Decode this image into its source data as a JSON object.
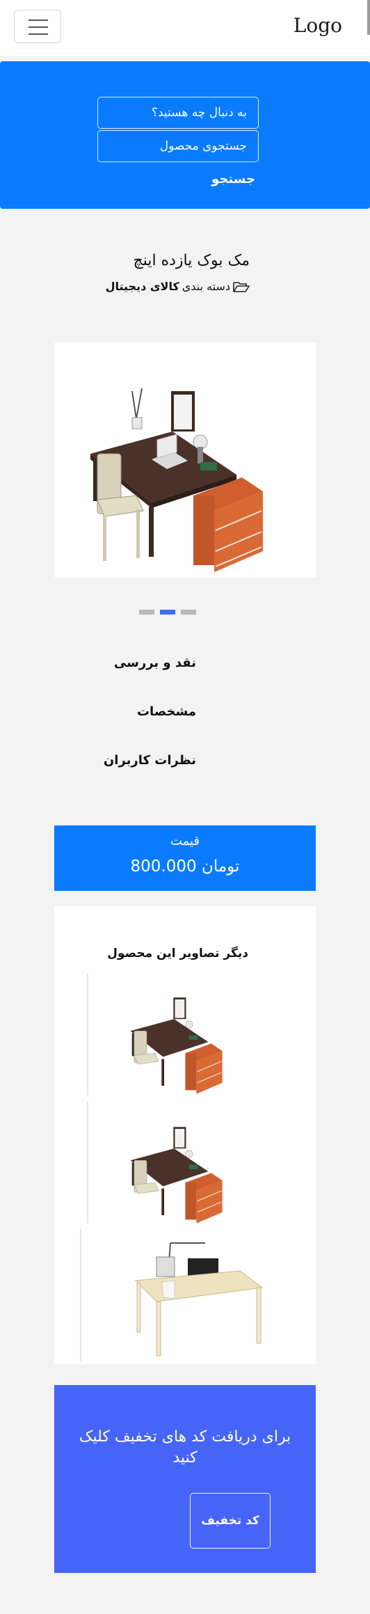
{
  "navbar": {
    "logo": "Logo",
    "menu_icon": "hamburger-icon"
  },
  "search": {
    "placeholder_question": "به دنبال چه هستید؟",
    "placeholder_product": "جستجوی محصول",
    "submit_label": "جستجو"
  },
  "product": {
    "title": "مک بوک یازده اینچ",
    "category_label": "دسته بندی",
    "category_value": "کالای دیجیتال",
    "category_icon": "folder-open-icon"
  },
  "carousel": {
    "total": 3,
    "active_index": 2
  },
  "tabs": [
    "نقد و بررسی",
    "مشخصات",
    "نظرات کاربران"
  ],
  "price": {
    "label": "قیمت",
    "value": "800.000 تومان"
  },
  "gallery": {
    "title": "دیگر تصاویر این محصول"
  },
  "discount": {
    "text": "برای دریافت کد های تخفیف کلیک کنید",
    "button_label": "کد تخفیف"
  },
  "colors": {
    "primary": "#0a7bff",
    "discount_bg": "#4664f7",
    "carousel_active": "#3e6ff2"
  }
}
